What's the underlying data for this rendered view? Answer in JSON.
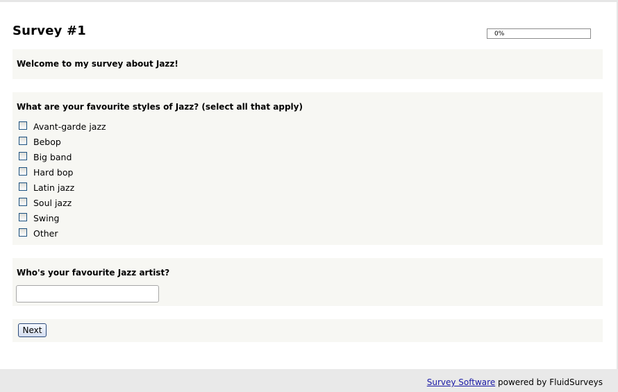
{
  "survey": {
    "title": "Survey #1",
    "progress_percent": 0,
    "progress_label": "0%",
    "welcome": "Welcome to my survey about Jazz!"
  },
  "question1": {
    "text": "What are your favourite styles of Jazz? (select all that apply)",
    "options": [
      {
        "label": "Avant-garde jazz",
        "checked": false
      },
      {
        "label": "Bebop",
        "checked": false
      },
      {
        "label": "Big band",
        "checked": false
      },
      {
        "label": "Hard bop",
        "checked": false
      },
      {
        "label": "Latin jazz",
        "checked": false
      },
      {
        "label": "Soul jazz",
        "checked": false
      },
      {
        "label": "Swing",
        "checked": false
      },
      {
        "label": "Other",
        "checked": false
      }
    ]
  },
  "question2": {
    "text": "Who's your favourite Jazz artist?",
    "value": ""
  },
  "navigation": {
    "next_label": "Next"
  },
  "footer": {
    "link_text": "Survey Software",
    "suffix": " powered by FluidSurveys"
  },
  "colors": {
    "panel_background": "#f7f7f3",
    "footer_background": "#e9e9e9",
    "link": "#1a1aa6"
  }
}
